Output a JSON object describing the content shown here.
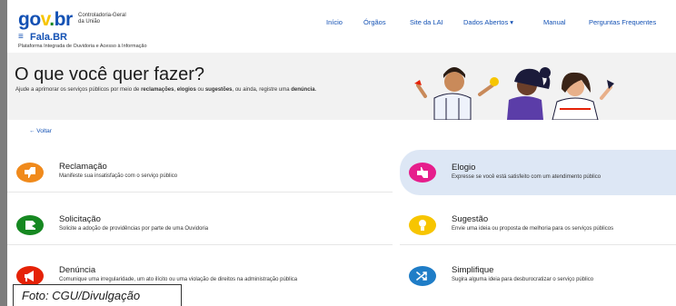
{
  "header": {
    "logo_parts": [
      "go",
      "v",
      ".",
      "br"
    ],
    "org_name_line1": "Controladoria-Geral",
    "org_name_line2": "da União",
    "menu_icon": "≡",
    "app_name": "Fala.BR",
    "app_subtitle": "Plataforma Integrada de Ouvidoria e Acesso à Informação",
    "nav": [
      {
        "label": "Início"
      },
      {
        "label": "Órgãos"
      },
      {
        "label": "Site da LAI"
      },
      {
        "label": "Dados Abertos ▾"
      },
      {
        "label": "Manual"
      },
      {
        "label": "Perguntas Frequentes"
      }
    ]
  },
  "banner": {
    "title": "O que você quer fazer?",
    "text_before": "Ajude a aprimorar os serviços públicos por meio de ",
    "kw1": "reclamações",
    "sep1": ", ",
    "kw2": "elogios",
    "sep2": " ou ",
    "kw3": "sugestões",
    "text_middle": ", ou ainda, registre uma ",
    "kw4": "denúncia",
    "text_end": "."
  },
  "back_label": "← Voltar",
  "cards": [
    {
      "title": "Reclamação",
      "desc": "Manifeste sua insatisfação com o serviço público",
      "color": "#f08a1c",
      "icon": "thumbs-down-icon"
    },
    {
      "title": "Elogio",
      "desc": "Expresse se você está satisfeito com um atendimento público",
      "color": "#e61e8c",
      "icon": "thumbs-up-icon"
    },
    {
      "title": "Solicitação",
      "desc": "Solicite a adoção de providências por parte de uma Ouvidoria",
      "color": "#168821",
      "icon": "request-icon"
    },
    {
      "title": "Sugestão",
      "desc": "Envie uma ideia ou proposta de melhoria para os serviços públicos",
      "color": "#f7c500",
      "icon": "lightbulb-icon"
    },
    {
      "title": "Denúncia",
      "desc": "Comunique uma irregularidade, um ato ilícito ou uma violação de direitos na administração pública",
      "color": "#e52207",
      "icon": "megaphone-icon"
    },
    {
      "title": "Simplifique",
      "desc": "Sugira alguma ideia para desburocratizar o serviço público",
      "color": "#1f7dc7",
      "icon": "shuffle-icon"
    }
  ],
  "colors": {
    "brand_blue": "#1351b4",
    "banner_bg": "#f2f2f2",
    "active_card_bg": "#dde7f5"
  },
  "caption": "Foto: CGU/Divulgação"
}
